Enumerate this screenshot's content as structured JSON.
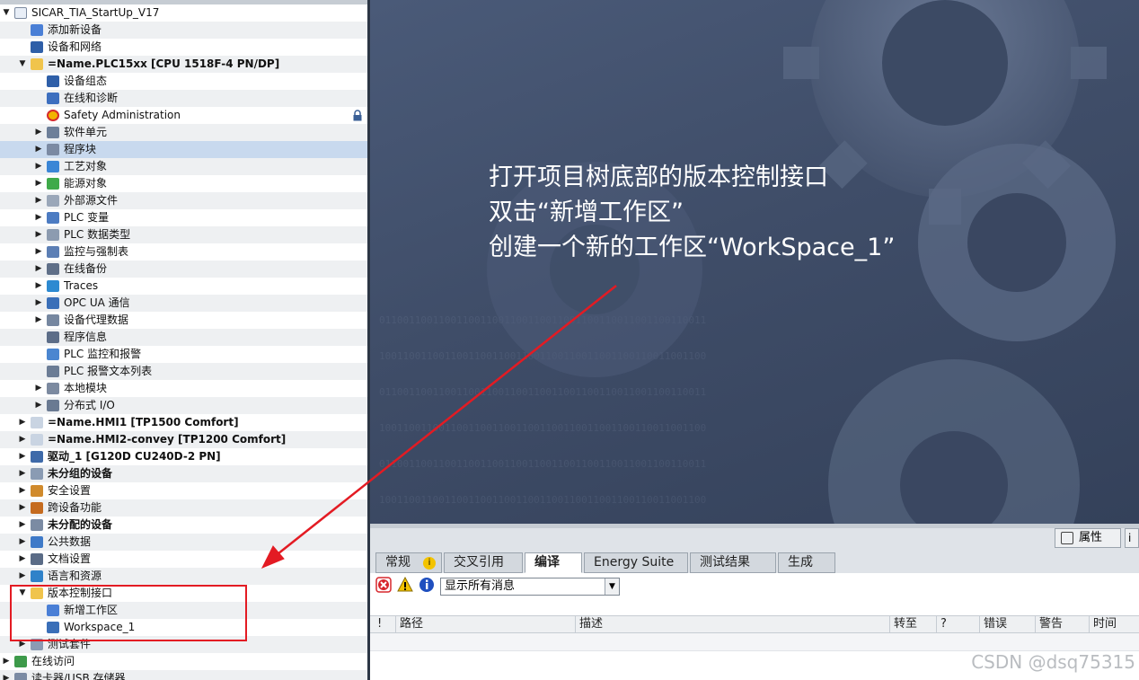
{
  "tree": {
    "items": [
      {
        "label": "SICAR_TIA_StartUp_V17",
        "level": 0,
        "toggle": "expanded",
        "icon": "project-icon",
        "bold": false
      },
      {
        "label": "添加新设备",
        "level": 1,
        "toggle": "none",
        "icon": "add-device-icon",
        "bold": false
      },
      {
        "label": "设备和网络",
        "level": 1,
        "toggle": "none",
        "icon": "network-icon",
        "bold": false
      },
      {
        "label": "=Name.PLC15xx [CPU 1518F-4 PN/DP]",
        "level": 1,
        "toggle": "expanded",
        "icon": "plc-icon",
        "bold": true
      },
      {
        "label": "设备组态",
        "level": 2,
        "toggle": "none",
        "icon": "device-config-icon",
        "bold": false
      },
      {
        "label": "在线和诊断",
        "level": 2,
        "toggle": "none",
        "icon": "online-diagnostics-icon",
        "bold": false
      },
      {
        "label": "Safety Administration",
        "level": 2,
        "toggle": "none",
        "icon": "safety-icon",
        "bold": false,
        "lock": true
      },
      {
        "label": "软件单元",
        "level": 2,
        "toggle": "collapsed",
        "icon": "software-units-icon",
        "bold": false
      },
      {
        "label": "程序块",
        "level": 2,
        "toggle": "collapsed",
        "icon": "program-blocks-icon",
        "bold": false,
        "selected": true
      },
      {
        "label": "工艺对象",
        "level": 2,
        "toggle": "collapsed",
        "icon": "technology-objects-icon",
        "bold": false
      },
      {
        "label": "能源对象",
        "level": 2,
        "toggle": "collapsed",
        "icon": "energy-objects-icon",
        "bold": false
      },
      {
        "label": "外部源文件",
        "level": 2,
        "toggle": "collapsed",
        "icon": "external-source-icon",
        "bold": false
      },
      {
        "label": "PLC 变量",
        "level": 2,
        "toggle": "collapsed",
        "icon": "plc-tags-icon",
        "bold": false
      },
      {
        "label": "PLC 数据类型",
        "level": 2,
        "toggle": "collapsed",
        "icon": "plc-data-types-icon",
        "bold": false
      },
      {
        "label": "监控与强制表",
        "level": 2,
        "toggle": "collapsed",
        "icon": "watch-table-icon",
        "bold": false
      },
      {
        "label": "在线备份",
        "level": 2,
        "toggle": "collapsed",
        "icon": "online-backup-icon",
        "bold": false
      },
      {
        "label": "Traces",
        "level": 2,
        "toggle": "collapsed",
        "icon": "traces-icon",
        "bold": false
      },
      {
        "label": "OPC UA 通信",
        "level": 2,
        "toggle": "collapsed",
        "icon": "opc-ua-icon",
        "bold": false
      },
      {
        "label": "设备代理数据",
        "level": 2,
        "toggle": "collapsed",
        "icon": "device-proxy-icon",
        "bold": false
      },
      {
        "label": "程序信息",
        "level": 2,
        "toggle": "none",
        "icon": "program-info-icon",
        "bold": false
      },
      {
        "label": "PLC 监控和报警",
        "level": 2,
        "toggle": "none",
        "icon": "plc-alarms-icon",
        "bold": false
      },
      {
        "label": "PLC 报警文本列表",
        "level": 2,
        "toggle": "none",
        "icon": "alarm-text-icon",
        "bold": false
      },
      {
        "label": "本地模块",
        "level": 2,
        "toggle": "collapsed",
        "icon": "local-modules-icon",
        "bold": false
      },
      {
        "label": "分布式 I/O",
        "level": 2,
        "toggle": "collapsed",
        "icon": "distributed-io-icon",
        "bold": false
      },
      {
        "label": "=Name.HMI1 [TP1500 Comfort]",
        "level": 1,
        "toggle": "collapsed",
        "icon": "hmi-icon",
        "bold": true
      },
      {
        "label": "=Name.HMI2-convey [TP1200 Comfort]",
        "level": 1,
        "toggle": "collapsed",
        "icon": "hmi-icon",
        "bold": true
      },
      {
        "label": "驱动_1 [G120D CU240D-2 PN]",
        "level": 1,
        "toggle": "collapsed",
        "icon": "drive-icon",
        "bold": true
      },
      {
        "label": "未分组的设备",
        "level": 1,
        "toggle": "collapsed",
        "icon": "ungrouped-devices-icon",
        "bold": true
      },
      {
        "label": "安全设置",
        "level": 1,
        "toggle": "collapsed",
        "icon": "security-settings-icon",
        "bold": false
      },
      {
        "label": "跨设备功能",
        "level": 1,
        "toggle": "collapsed",
        "icon": "cross-device-icon",
        "bold": false
      },
      {
        "label": "未分配的设备",
        "level": 1,
        "toggle": "collapsed",
        "icon": "unassigned-devices-icon",
        "bold": true
      },
      {
        "label": "公共数据",
        "level": 1,
        "toggle": "collapsed",
        "icon": "common-data-icon",
        "bold": false
      },
      {
        "label": "文档设置",
        "level": 1,
        "toggle": "collapsed",
        "icon": "documentation-settings-icon",
        "bold": false
      },
      {
        "label": "语言和资源",
        "level": 1,
        "toggle": "collapsed",
        "icon": "languages-icon",
        "bold": false
      },
      {
        "label": "版本控制接口",
        "level": 1,
        "toggle": "expanded",
        "icon": "version-control-icon",
        "bold": false
      },
      {
        "label": "新增工作区",
        "level": 2,
        "toggle": "none",
        "icon": "add-workspace-icon",
        "bold": false
      },
      {
        "label": "Workspace_1",
        "level": 2,
        "toggle": "none",
        "icon": "workspace-icon",
        "bold": false
      },
      {
        "label": "测试套件",
        "level": 1,
        "toggle": "collapsed",
        "icon": "test-suite-icon",
        "bold": false
      },
      {
        "label": "在线访问",
        "level": 0,
        "toggle": "collapsed",
        "icon": "online-access-icon",
        "bold": false
      },
      {
        "label": "读卡器/USB 存储器",
        "level": 0,
        "toggle": "collapsed",
        "icon": "card-reader-icon",
        "bold": false
      }
    ]
  },
  "annotation": {
    "lines": [
      "打开项目树底部的版本控制接口",
      "双击“新增工作区”",
      "创建一个新的工作区“WorkSpace_1”"
    ],
    "color": "#e31b23"
  },
  "inspector": {
    "properties_label": "属性",
    "info_label": "i",
    "tabs": [
      {
        "label": "常规",
        "active": false,
        "info_icon": true
      },
      {
        "label": "交叉引用",
        "active": false,
        "info_icon": false
      },
      {
        "label": "编译",
        "active": true,
        "info_icon": false
      },
      {
        "label": "Energy Suite",
        "active": false,
        "info_icon": false
      },
      {
        "label": "测试结果",
        "active": false,
        "info_icon": false
      },
      {
        "label": "生成",
        "active": false,
        "info_icon": false
      }
    ],
    "filter_value": "显示所有消息",
    "columns": [
      "!",
      "路径",
      "描述",
      "转至",
      "?",
      "错误",
      "警告",
      "时间"
    ]
  },
  "watermark": "CSDN @dsq75315"
}
